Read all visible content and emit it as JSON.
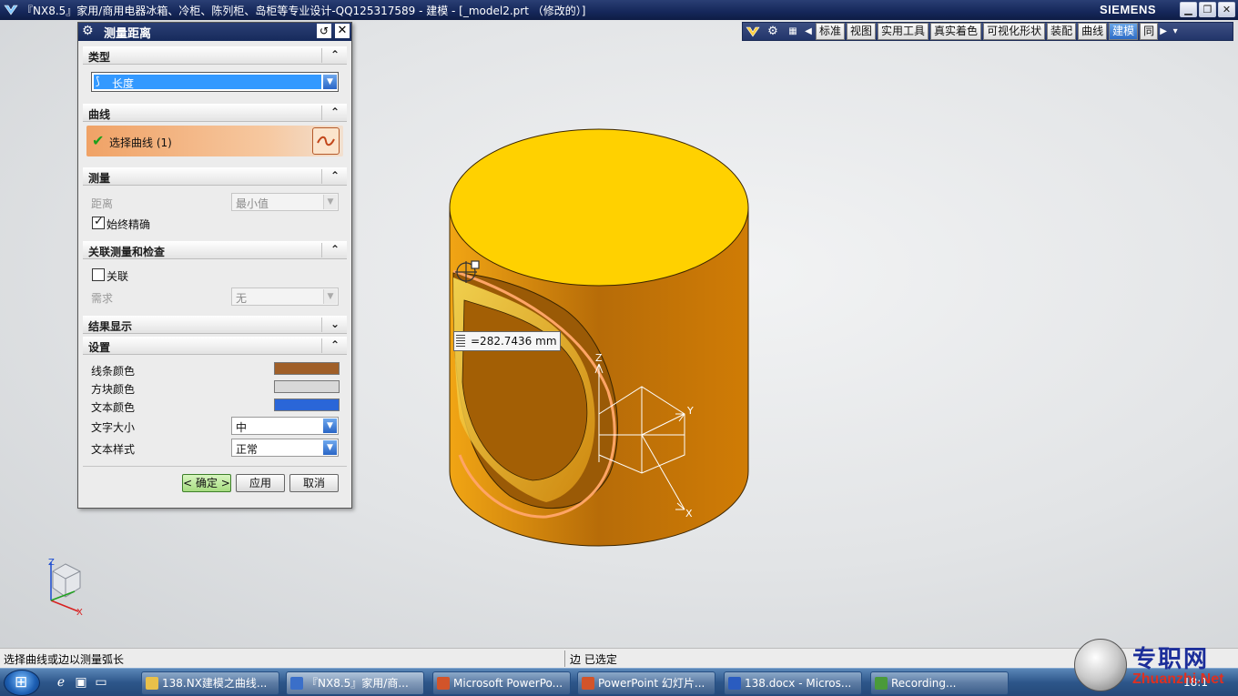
{
  "window": {
    "title": "『NX8.5』家用/商用电器冰箱、冷柜、陈列柜、岛柜等专业设计-QQ125317589 - 建模 - [_model2.prt （修改的）]",
    "brand": "SIEMENS",
    "controls": {
      "minimize": "▁",
      "restore": "❐",
      "close": "✕"
    }
  },
  "toolbar": {
    "tabs": [
      "标准",
      "视图",
      "实用工具",
      "真实着色",
      "可视化形状",
      "装配",
      "曲线",
      "建模",
      "同"
    ],
    "active_tab": "建模",
    "icons": [
      "nx-logo-icon",
      "gear-icon",
      "grid-icon",
      "arrow-left-icon",
      "arrow-right-icon",
      "dropdown-icon"
    ]
  },
  "dialog": {
    "title": "测量距离",
    "sections": {
      "type": {
        "label": "类型",
        "value": "长度",
        "icon": "length-icon"
      },
      "curve": {
        "label": "曲线",
        "select_label": "选择曲线 (1)",
        "icon": "curve-icon"
      },
      "measure": {
        "label": "测量",
        "distance_label": "距离",
        "distance_value": "最小值",
        "always_exact_label": "始终精确",
        "always_exact": true
      },
      "assoc": {
        "label": "关联测量和检查",
        "assoc_label": "关联",
        "assoc_checked": false,
        "requirement_label": "需求",
        "requirement_value": "无"
      },
      "result": {
        "label": "结果显示"
      },
      "settings": {
        "label": "设置",
        "line_color_label": "线条颜色",
        "block_color_label": "方块颜色",
        "text_color_label": "文本颜色",
        "text_size_label": "文字大小",
        "text_size_value": "中",
        "text_style_label": "文本样式",
        "text_style_value": "正常",
        "line_color": "#a05f28",
        "block_color": "#d8d8d8",
        "text_color": "#2a66d8"
      }
    },
    "buttons": {
      "ok": "< 确定 >",
      "apply": "应用",
      "cancel": "取消"
    }
  },
  "viewport": {
    "measurement": "=282.7436 mm",
    "csys_labels": {
      "z": "Z",
      "y": "Y",
      "x": "X"
    },
    "cylinder_top_color": "#ffd100",
    "cylinder_side_color": "#e48a00"
  },
  "status": {
    "prompt": "选择曲线或边以测量弧长",
    "selection": "边 已选定"
  },
  "taskbar": {
    "tasks": [
      {
        "label": "138.NX建模之曲线...",
        "color": "#e8c04a"
      },
      {
        "label": "『NX8.5』家用/商...",
        "color": "#3a6fc9"
      },
      {
        "label": "Microsoft PowerPo...",
        "color": "#d2542a"
      },
      {
        "label": "PowerPoint 幻灯片...",
        "color": "#d2542a"
      },
      {
        "label": "138.docx - Micros...",
        "color": "#2a5cc0"
      },
      {
        "label": "Recording...",
        "color": "#4a9a3a"
      }
    ],
    "clock": "18:1"
  },
  "watermark": {
    "cn": "专职网",
    "en": "Zhuanzhi.Net"
  }
}
